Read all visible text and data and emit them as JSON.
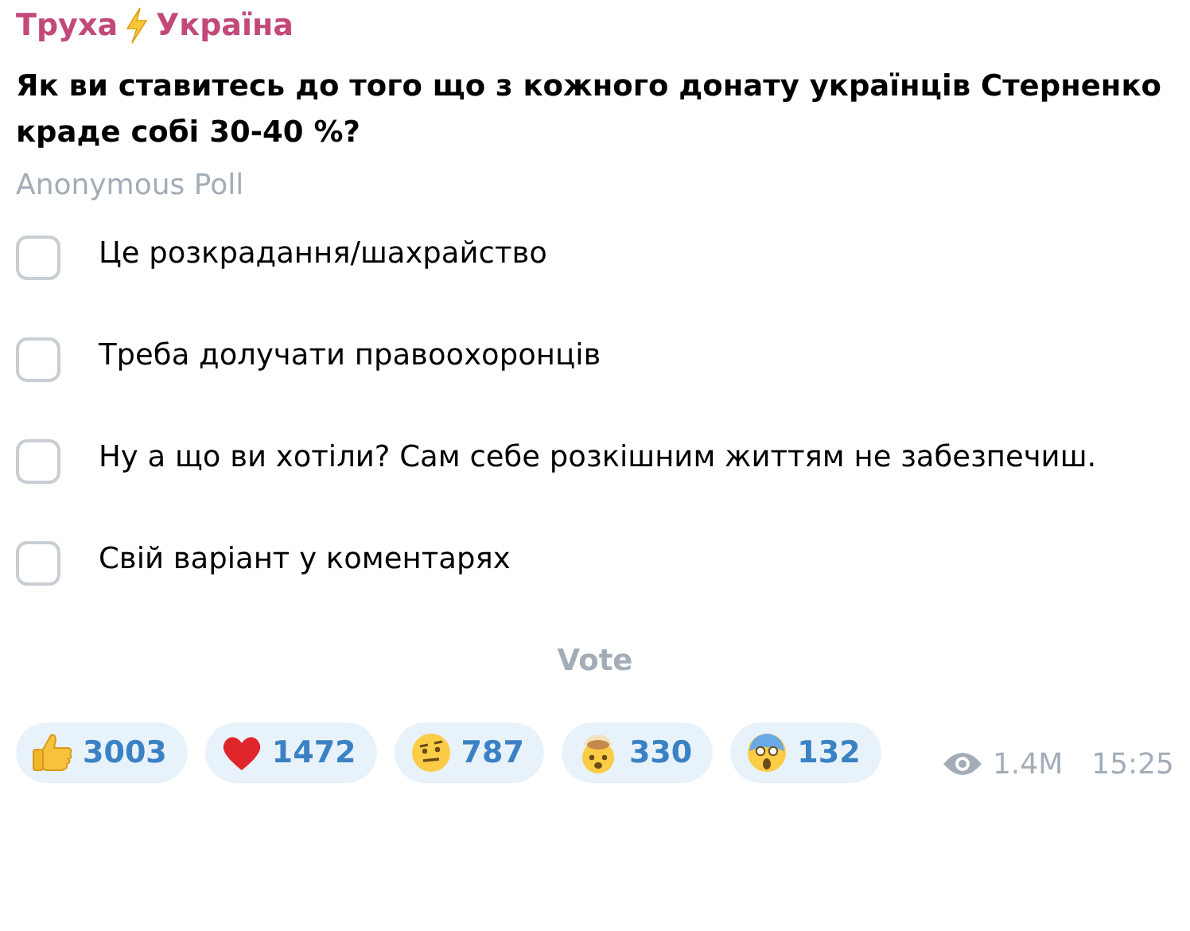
{
  "channel": {
    "name_parts": [
      "Труха",
      "Україна"
    ]
  },
  "poll": {
    "question": "Як ви ставитесь до того що з кожного донату українців Стерненко краде собі 30-40 %?",
    "type": "Anonymous Poll",
    "options": [
      {
        "label": "Це розкрадання/шахрайство",
        "checked": false
      },
      {
        "label": "Треба долучати правоохоронців",
        "checked": false
      },
      {
        "label": "Ну а що ви хотіли? Сам себе розкішним життям не забезпечиш.",
        "checked": false
      },
      {
        "label": "Свій варіант у коментарях",
        "checked": false
      }
    ],
    "vote_button": "Vote"
  },
  "reactions": [
    {
      "kind": "thumbs",
      "count": "3003"
    },
    {
      "kind": "heart",
      "count": "1472"
    },
    {
      "kind": "raised-brow",
      "count": "787"
    },
    {
      "kind": "exploding",
      "count": "330"
    },
    {
      "kind": "scream",
      "count": "132"
    }
  ],
  "views": "1.4M",
  "time": "15:25"
}
